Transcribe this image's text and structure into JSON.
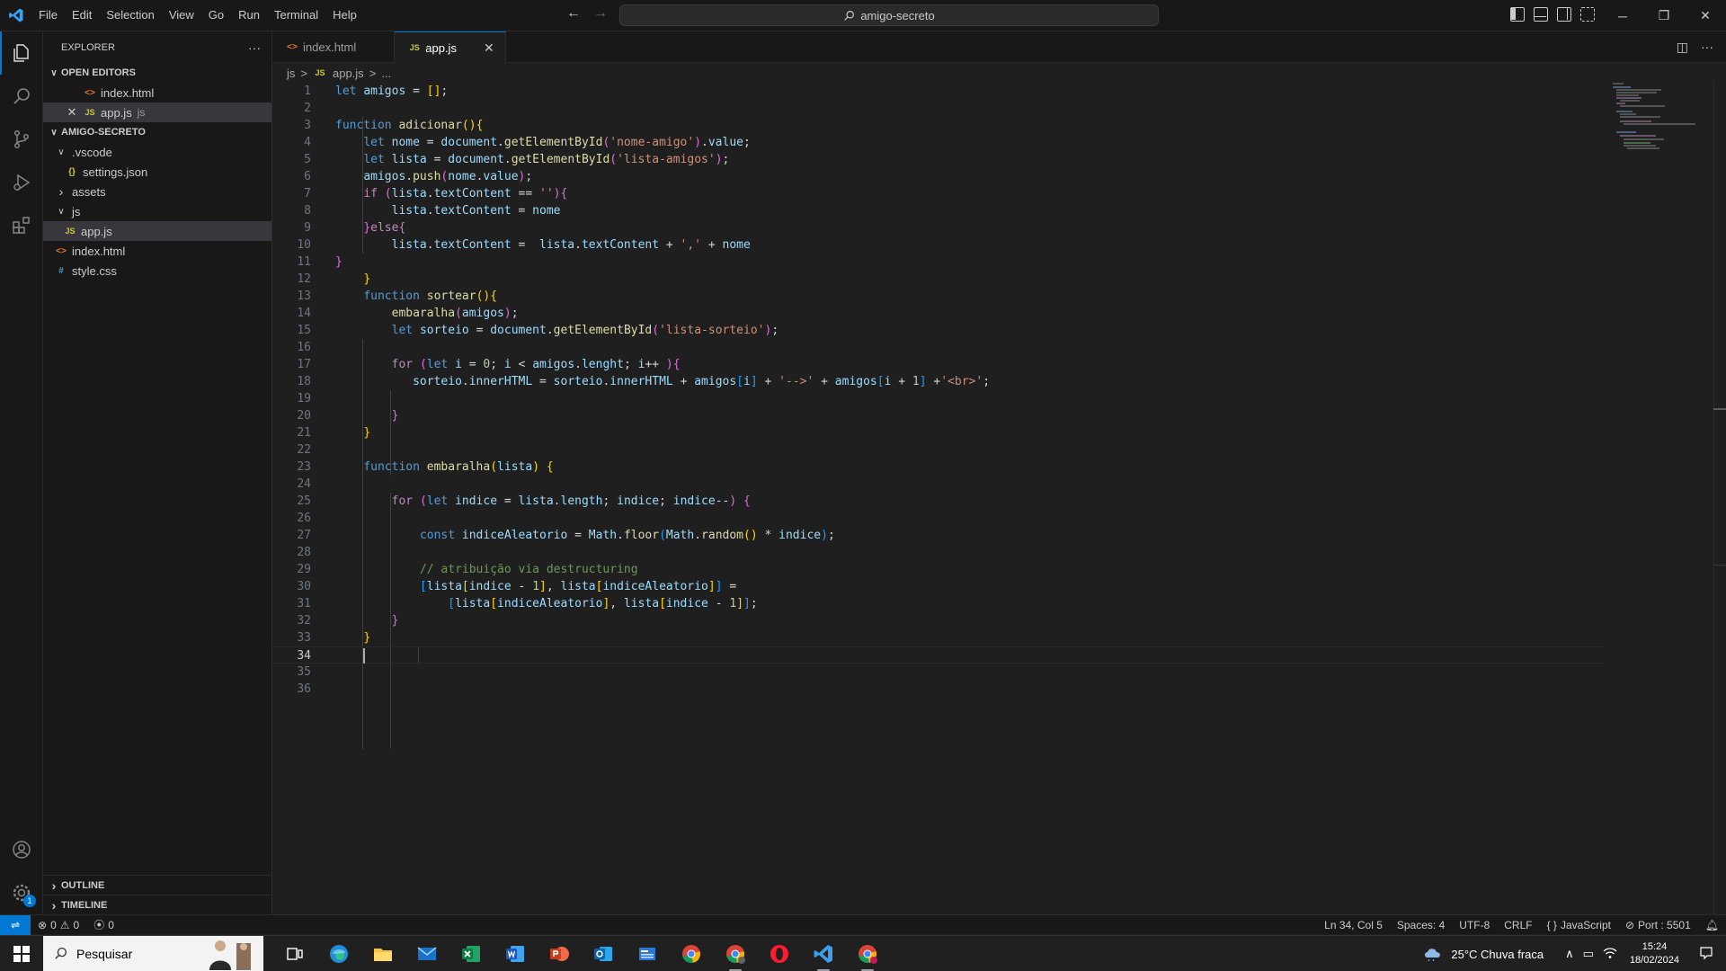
{
  "menu": [
    "File",
    "Edit",
    "Selection",
    "View",
    "Go",
    "Run",
    "Terminal",
    "Help"
  ],
  "command_center": {
    "text": "amigo-secreto"
  },
  "sidebar": {
    "title": "EXPLORER",
    "more": "···",
    "open_editors_label": "OPEN EDITORS",
    "open_editors": [
      {
        "icon": "<>",
        "name": "index.html",
        "hint": ""
      },
      {
        "icon": "JS",
        "name": "app.js",
        "hint": "js"
      }
    ],
    "project_label": "AMIGO-SECRETO",
    "tree": [
      {
        "chev": "∨",
        "icon": "",
        "name": ".vscode"
      },
      {
        "chev": "",
        "icon": "{}",
        "name": "settings.json"
      },
      {
        "chev": "›",
        "icon": "",
        "name": "assets"
      },
      {
        "chev": "∨",
        "icon": "",
        "name": "js"
      },
      {
        "chev": "",
        "icon": "JS",
        "name": "app.js"
      },
      {
        "chev": "",
        "icon": "<>",
        "name": "index.html"
      },
      {
        "chev": "",
        "icon": "#",
        "name": "style.css"
      }
    ],
    "outline_label": "OUTLINE",
    "timeline_label": "TIMELINE"
  },
  "tabs": [
    {
      "icon": "<>",
      "label": "index.html"
    },
    {
      "icon": "JS",
      "label": "app.js",
      "close": "✕"
    }
  ],
  "breadcrumb": {
    "folder": "js",
    "sep": ">",
    "icon": "JS",
    "file": "app.js",
    "tail": "..."
  },
  "editor": {
    "current_line": 34,
    "line_numbers": [
      "1",
      "2",
      "3",
      "4",
      "5",
      "6",
      "7",
      "8",
      "9",
      "10",
      "11",
      "12",
      "13",
      "14",
      "15",
      "16",
      "17",
      "18",
      "19",
      "20",
      "21",
      "22",
      "23",
      "24",
      "25",
      "26",
      "27",
      "28",
      "29",
      "30",
      "31",
      "32",
      "33",
      "34",
      "35",
      "36"
    ],
    "code": [
      "let amigos = [];",
      "",
      "function adicionar(){",
      "    let nome = document.getElementById('nome-amigo').value;",
      "    let lista = document.getElementById('lista-amigos');",
      "    amigos.push(nome.value);",
      "    if (lista.textContent == ''){",
      "        lista.textContent = nome",
      "    }else{",
      "        lista.textContent =  lista.textContent + ',' + nome",
      "}",
      "    }",
      "    function sortear(){",
      "        embaralha(amigos);",
      "        let sorteio = document.getElementById('lista-sorteio');",
      "",
      "        for (let i = 0; i < amigos.lenght; i++ ){",
      "           sorteio.innerHTML = sorteio.innerHTML + amigos[i] + '-->' + amigos[i + 1] +'<br>';",
      "",
      "        }",
      "    }",
      "",
      "    function embaralha(lista) {",
      "",
      "        for (let indice = lista.length; indice; indice--) {",
      "",
      "            const indiceAleatorio = Math.floor(Math.random() * indice);",
      "",
      "            // atribuição via destructuring",
      "            [lista[indice - 1], lista[indiceAleatorio]] =",
      "                [lista[indiceAleatorio], lista[indice - 1]];",
      "        }",
      "    }",
      "    ",
      "",
      ""
    ]
  },
  "status": {
    "errors": "0",
    "warnings": "0",
    "ports": "0",
    "position": "Ln 34, Col 5",
    "spaces": "Spaces: 4",
    "encoding": "UTF-8",
    "eol": "CRLF",
    "language": "JavaScript",
    "port": "Port : 5501"
  },
  "activity_badge": "1",
  "taskbar": {
    "search_placeholder": "Pesquisar",
    "weather": "25°C  Chuva fraca",
    "time": "15:24",
    "date": "18/02/2024"
  },
  "colors": {
    "accent": "#0078d4",
    "editor_bg": "#1f1f1f",
    "sidebar_bg": "#181818"
  }
}
